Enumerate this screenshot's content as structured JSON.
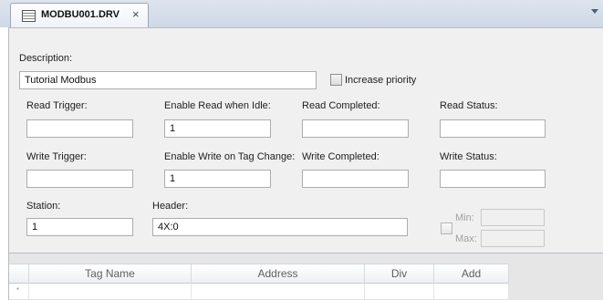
{
  "tab": {
    "title": "MODBU001.DRV",
    "close_glyph": "×",
    "icon": "driver-file-icon"
  },
  "form": {
    "description": {
      "label": "Description:",
      "value": "Tutorial Modbus"
    },
    "increase_priority": {
      "label": "Increase priority",
      "checked": false
    },
    "read_trigger": {
      "label": "Read Trigger:",
      "value": ""
    },
    "enable_read_when_idle": {
      "label": "Enable Read when Idle:",
      "value": "1"
    },
    "read_completed": {
      "label": "Read Completed:",
      "value": ""
    },
    "read_status": {
      "label": "Read Status:",
      "value": ""
    },
    "write_trigger": {
      "label": "Write Trigger:",
      "value": ""
    },
    "enable_write_on_tag_change": {
      "label": "Enable Write on Tag Change:",
      "value": "1"
    },
    "write_completed": {
      "label": "Write Completed:",
      "value": ""
    },
    "write_status": {
      "label": "Write Status:",
      "value": ""
    },
    "station": {
      "label": "Station:",
      "value": "1"
    },
    "header": {
      "label": "Header:",
      "value": "4X:0"
    },
    "min_max": {
      "min_label": "Min:",
      "max_label": "Max:",
      "min_value": "",
      "max_value": "",
      "enabled": false
    }
  },
  "grid": {
    "columns": [
      "Tag Name",
      "Address",
      "Div",
      "Add"
    ],
    "rows": [
      {
        "marker": "*",
        "cells": [
          "",
          "",
          "",
          ""
        ]
      }
    ]
  },
  "colors": {
    "tab_strip": "#d6dde9",
    "form_background": "#f0f0f0",
    "grid_background": "#e6e6e6",
    "field_border": "#abadb3"
  }
}
